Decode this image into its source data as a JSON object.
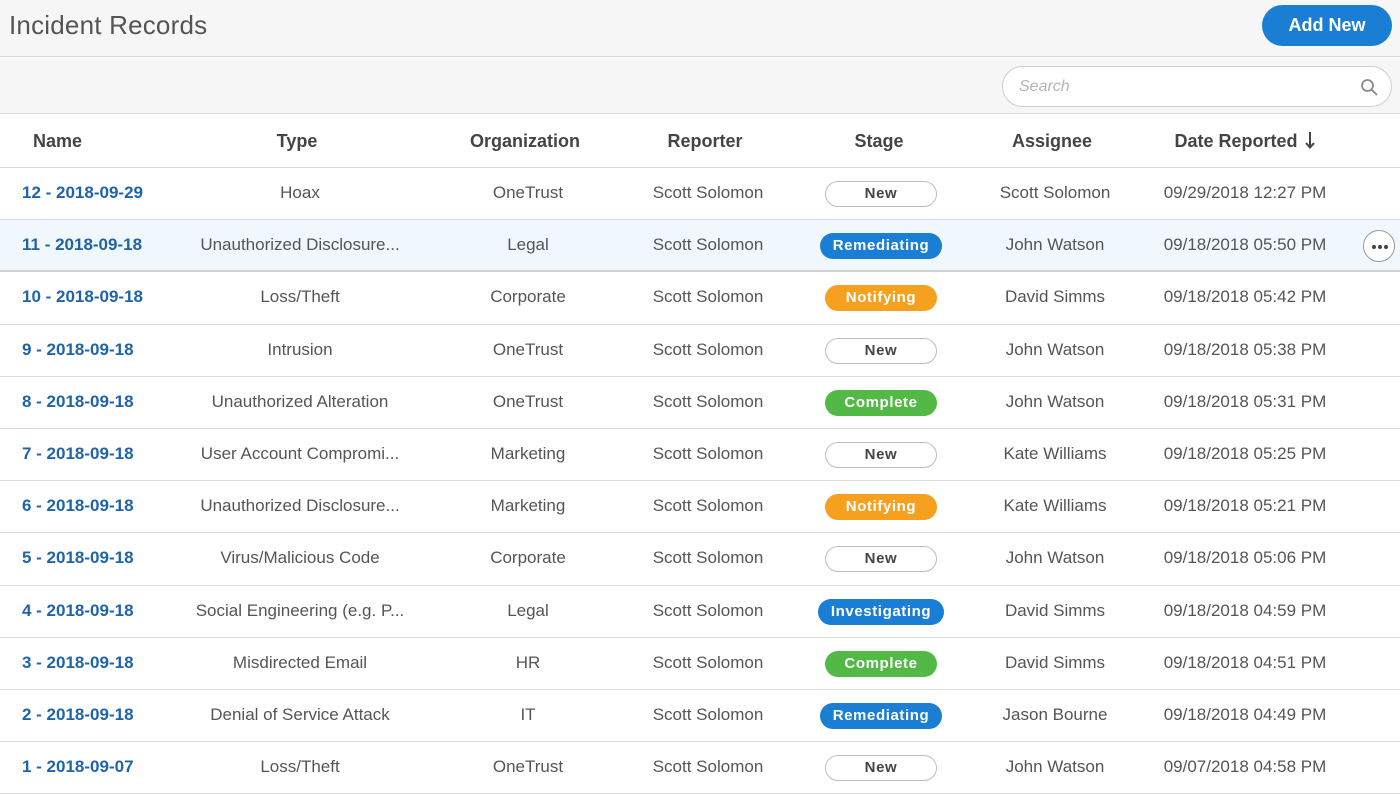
{
  "header": {
    "title": "Incident Records",
    "add_label": "Add New"
  },
  "search": {
    "placeholder": "Search"
  },
  "columns": {
    "name": "Name",
    "type": "Type",
    "organization": "Organization",
    "reporter": "Reporter",
    "stage": "Stage",
    "assignee": "Assignee",
    "date": "Date Reported"
  },
  "colors": {
    "accent": "#1a7fd4",
    "link": "#1f63a8",
    "notifying": "#f5a01f",
    "complete": "#52b846"
  },
  "rows": [
    {
      "name": "12 - 2018-09-29",
      "type": "Hoax",
      "organization": "OneTrust",
      "reporter": "Scott Solomon",
      "stage": "New",
      "stage_kind": "new",
      "assignee": "Scott Solomon",
      "date": "09/29/2018 12:27 PM"
    },
    {
      "name": "11 - 2018-09-18",
      "type": "Unauthorized Disclosure...",
      "organization": "Legal",
      "reporter": "Scott Solomon",
      "stage": "Remediating",
      "stage_kind": "remediating",
      "assignee": "John Watson",
      "date": "09/18/2018 05:50 PM"
    },
    {
      "name": "10 - 2018-09-18",
      "type": "Loss/Theft",
      "organization": "Corporate",
      "reporter": "Scott Solomon",
      "stage": "Notifying",
      "stage_kind": "notifying",
      "assignee": "David Simms",
      "date": "09/18/2018 05:42 PM"
    },
    {
      "name": "9 - 2018-09-18",
      "type": "Intrusion",
      "organization": "OneTrust",
      "reporter": "Scott Solomon",
      "stage": "New",
      "stage_kind": "new",
      "assignee": "John Watson",
      "date": "09/18/2018 05:38 PM"
    },
    {
      "name": "8 - 2018-09-18",
      "type": "Unauthorized Alteration",
      "organization": "OneTrust",
      "reporter": "Scott Solomon",
      "stage": "Complete",
      "stage_kind": "complete",
      "assignee": "John Watson",
      "date": "09/18/2018 05:31 PM"
    },
    {
      "name": "7 - 2018-09-18",
      "type": "User Account Compromi...",
      "organization": "Marketing",
      "reporter": "Scott Solomon",
      "stage": "New",
      "stage_kind": "new",
      "assignee": "Kate Williams",
      "date": "09/18/2018 05:25 PM"
    },
    {
      "name": "6 - 2018-09-18",
      "type": "Unauthorized Disclosure...",
      "organization": "Marketing",
      "reporter": "Scott Solomon",
      "stage": "Notifying",
      "stage_kind": "notifying",
      "assignee": "Kate Williams",
      "date": "09/18/2018 05:21 PM"
    },
    {
      "name": "5 - 2018-09-18",
      "type": "Virus/Malicious Code",
      "organization": "Corporate",
      "reporter": "Scott Solomon",
      "stage": "New",
      "stage_kind": "new",
      "assignee": "John Watson",
      "date": "09/18/2018 05:06 PM"
    },
    {
      "name": "4 - 2018-09-18",
      "type": "Social Engineering (e.g. P...",
      "organization": "Legal",
      "reporter": "Scott Solomon",
      "stage": "Investigating",
      "stage_kind": "investigating",
      "assignee": "David Simms",
      "date": "09/18/2018 04:59 PM"
    },
    {
      "name": "3 - 2018-09-18",
      "type": "Misdirected Email",
      "organization": "HR",
      "reporter": "Scott Solomon",
      "stage": "Complete",
      "stage_kind": "complete",
      "assignee": "David Simms",
      "date": "09/18/2018 04:51 PM"
    },
    {
      "name": "2 - 2018-09-18",
      "type": "Denial of Service Attack",
      "organization": "IT",
      "reporter": "Scott Solomon",
      "stage": "Remediating",
      "stage_kind": "remediating",
      "assignee": "Jason Bourne",
      "date": "09/18/2018 04:49 PM"
    },
    {
      "name": "1 - 2018-09-07",
      "type": "Loss/Theft",
      "organization": "OneTrust",
      "reporter": "Scott Solomon",
      "stage": "New",
      "stage_kind": "new",
      "assignee": "John Watson",
      "date": "09/07/2018 04:58 PM"
    }
  ]
}
